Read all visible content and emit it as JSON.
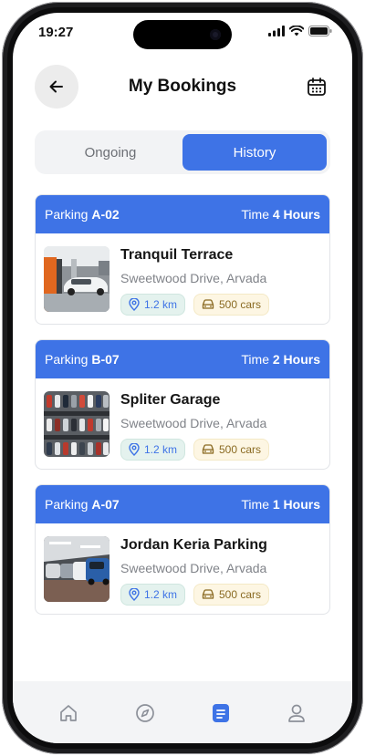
{
  "status_bar": {
    "time": "19:27"
  },
  "header": {
    "title": "My Bookings"
  },
  "tabs": [
    {
      "label": "Ongoing",
      "active": false
    },
    {
      "label": "History",
      "active": true
    }
  ],
  "bookings": [
    {
      "slot_prefix": "Parking",
      "slot": "A-02",
      "time_prefix": "Time",
      "duration": "4 Hours",
      "name": "Tranquil Terrace",
      "address": "Sweetwood Drive, Arvada",
      "distance": "1.2 km",
      "capacity": "500 cars"
    },
    {
      "slot_prefix": "Parking",
      "slot": "B-07",
      "time_prefix": "Time",
      "duration": "2 Hours",
      "name": "Spliter Garage",
      "address": "Sweetwood Drive, Arvada",
      "distance": "1.2 km",
      "capacity": "500 cars"
    },
    {
      "slot_prefix": "Parking",
      "slot": "A-07",
      "time_prefix": "Time",
      "duration": "1 Hours",
      "name": "Jordan Keria Parking",
      "address": "Sweetwood Drive, Arvada",
      "distance": "1.2 km",
      "capacity": "500 cars"
    }
  ],
  "bottom_nav": [
    {
      "icon": "home-icon",
      "active": false
    },
    {
      "icon": "compass-icon",
      "active": false
    },
    {
      "icon": "bookings-icon",
      "active": true
    },
    {
      "icon": "profile-icon",
      "active": false
    }
  ],
  "colors": {
    "accent": "#3e73e6",
    "nav_inactive": "#8c9099"
  }
}
